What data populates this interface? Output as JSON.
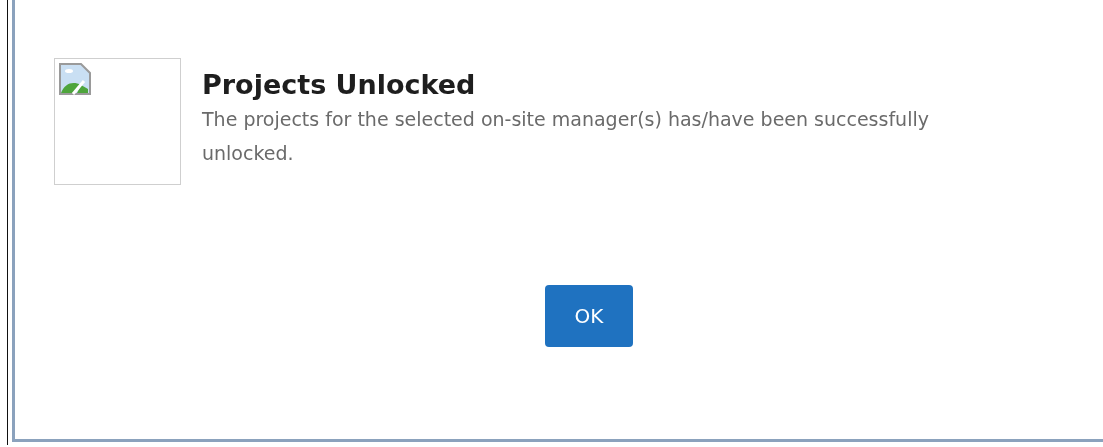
{
  "dialog": {
    "title": "Projects Unlocked",
    "message": "The projects for the selected on-site manager(s) has/have been successfully unlocked.",
    "buttons": [
      "OK"
    ]
  }
}
